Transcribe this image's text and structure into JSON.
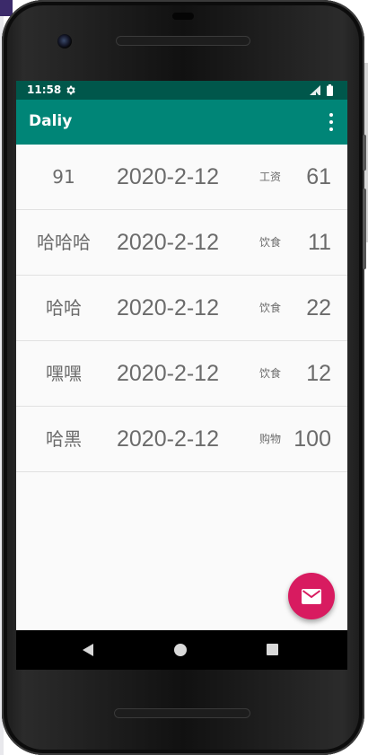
{
  "status_bar": {
    "time": "11:58",
    "icons": [
      "settings-gear-icon",
      "cell-signal-icon",
      "battery-icon"
    ]
  },
  "app_bar": {
    "title": "Daliy",
    "menu_icon": "overflow-menu-icon",
    "background_color": "#008577"
  },
  "colors": {
    "status_bar": "#00574b",
    "app_bar": "#008577",
    "fab": "#d81b60",
    "row_text": "#6b6b6b"
  },
  "records": [
    {
      "name": "91",
      "date": "2020-2-12",
      "type": "工资",
      "amount": "61"
    },
    {
      "name": "哈哈哈",
      "date": "2020-2-12",
      "type": "饮食",
      "amount": "11"
    },
    {
      "name": "哈哈",
      "date": "2020-2-12",
      "type": "饮食",
      "amount": "22"
    },
    {
      "name": "嘿嘿",
      "date": "2020-2-12",
      "type": "饮食",
      "amount": "12"
    },
    {
      "name": "哈黑",
      "date": "2020-2-12",
      "type": "购物",
      "amount": "100"
    }
  ],
  "fab": {
    "icon": "email-icon"
  },
  "nav_bar": {
    "icons": [
      "back-icon",
      "home-icon",
      "recents-icon"
    ]
  }
}
